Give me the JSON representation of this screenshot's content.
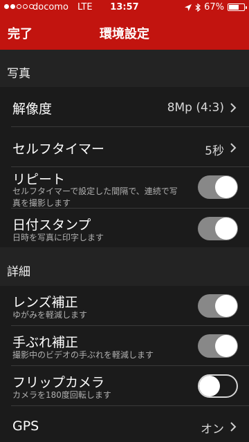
{
  "status": {
    "carrier": "docomo",
    "network": "LTE",
    "time": "13:57",
    "battery": "67%",
    "battery_level": 0.67
  },
  "nav": {
    "done_label": "完了",
    "title": "環境設定"
  },
  "sections": {
    "photo": {
      "header": "写真",
      "resolution": {
        "label": "解像度",
        "value": "8Mp (4:3)"
      },
      "self_timer": {
        "label": "セルフタイマー",
        "value": "5秒"
      },
      "repeat": {
        "label": "リピート",
        "description_line1": "セルフタイマーで設定した間隔で、連続で写",
        "description_line2": "真を撮影します",
        "enabled": true
      },
      "date_stamp": {
        "label": "日付スタンプ",
        "description": "日時を写真に印字します",
        "enabled": true
      }
    },
    "details": {
      "header": "詳細",
      "lens_correction": {
        "label": "レンズ補正",
        "description": "ゆがみを軽減します",
        "enabled": true
      },
      "stabilization": {
        "label": "手ぶれ補正",
        "description": "撮影中のビデオの手ぶれを軽減します",
        "enabled": true
      },
      "flip_camera": {
        "label": "フリップカメラ",
        "description": "カメラを180度回転します",
        "enabled": false
      },
      "gps": {
        "label": "GPS",
        "value": "オン"
      }
    }
  }
}
